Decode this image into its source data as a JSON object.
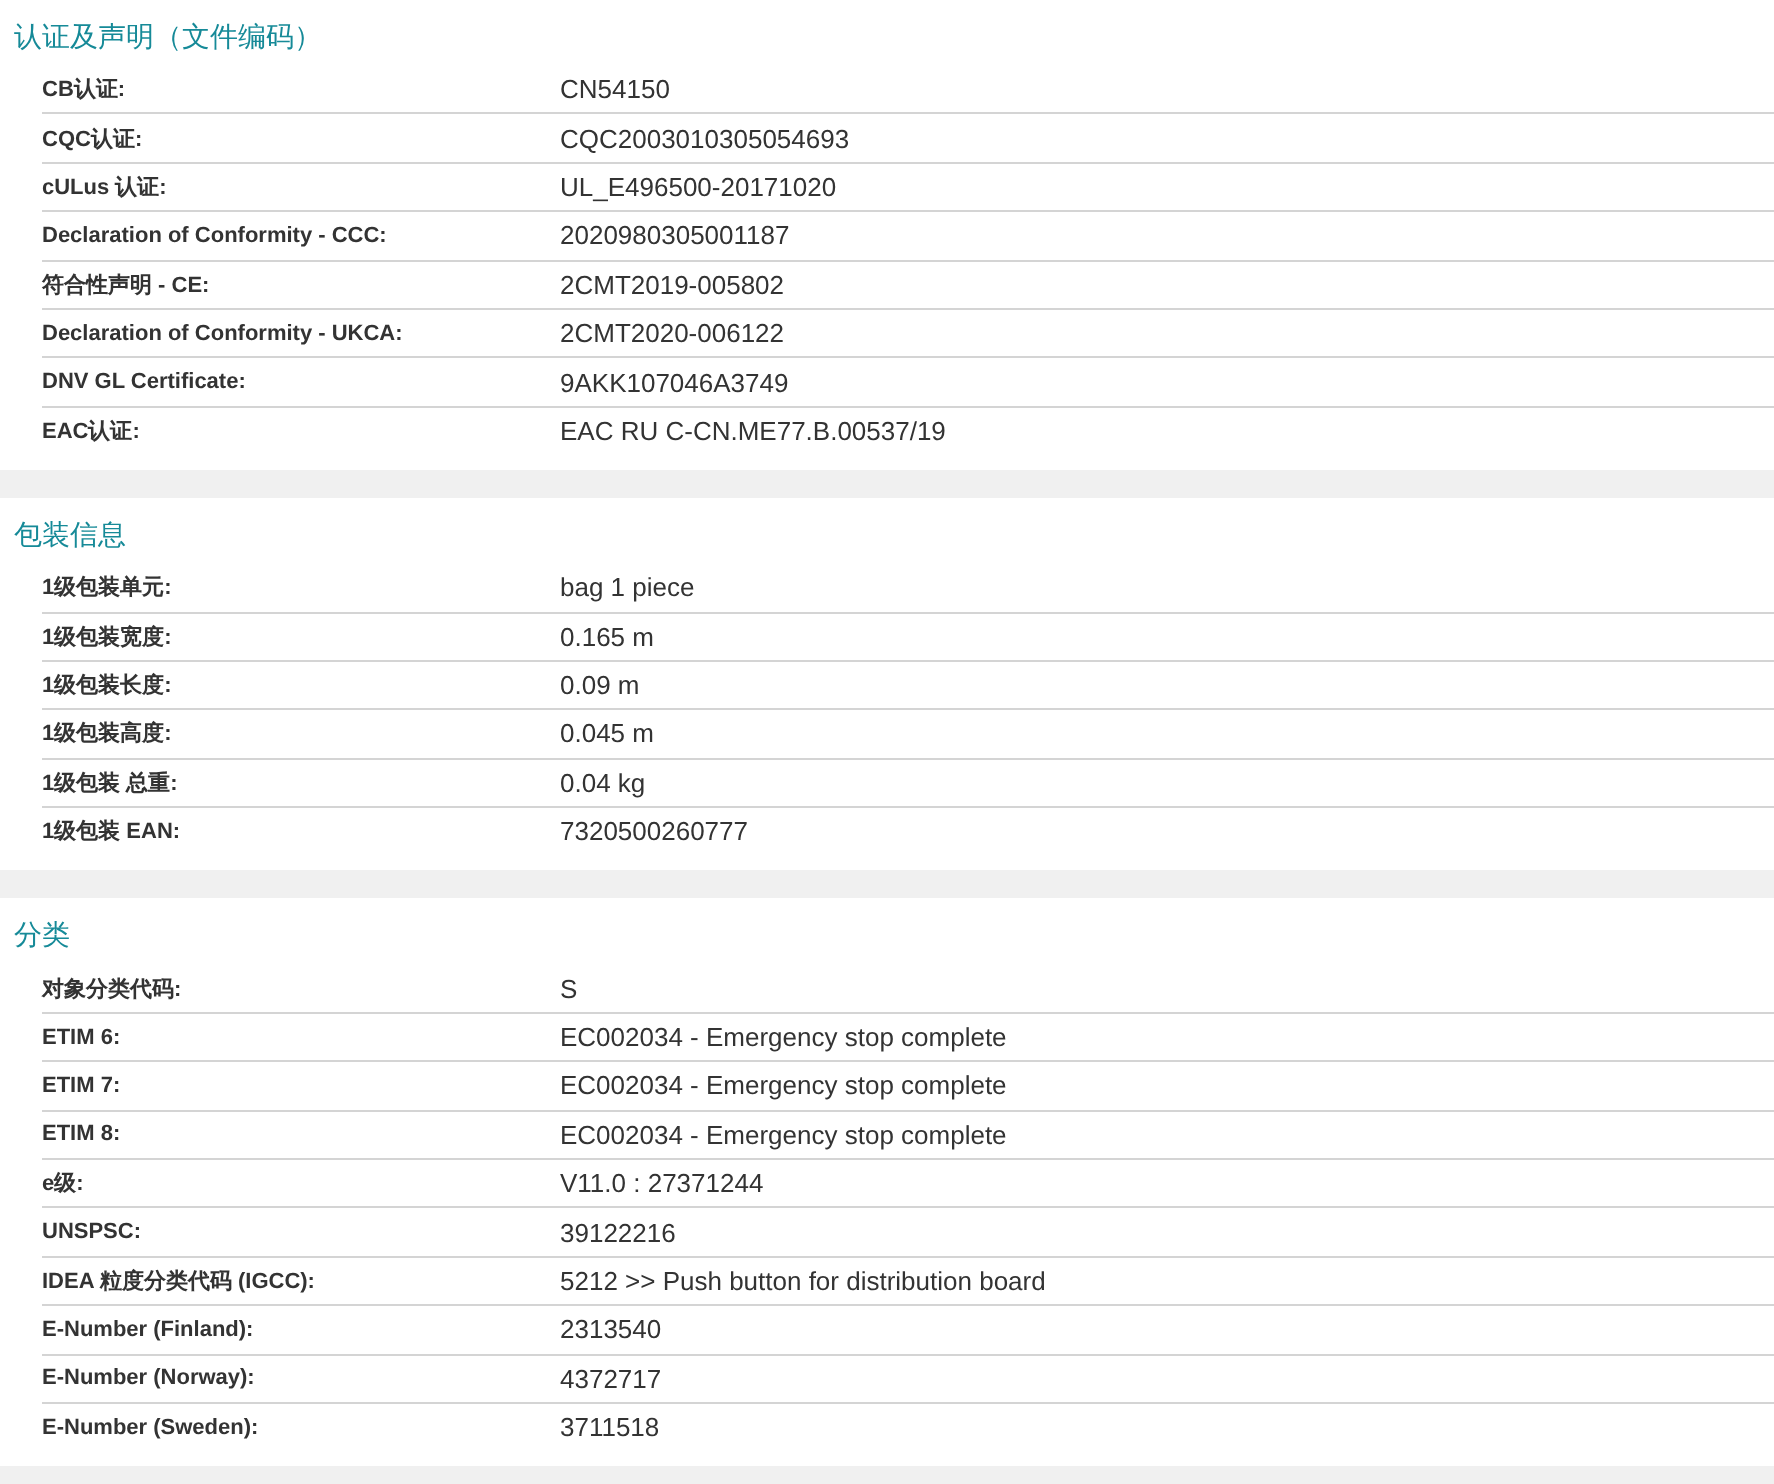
{
  "sections": [
    {
      "title": "认证及声明（文件编码）",
      "rows": [
        {
          "label": "CB认证:",
          "value": "CN54150"
        },
        {
          "label": "CQC认证:",
          "value": "CQC2003010305054693"
        },
        {
          "label": "cULus 认证:",
          "value": "UL_E496500-20171020"
        },
        {
          "label": "Declaration of Conformity - CCC:",
          "value": "2020980305001187"
        },
        {
          "label": "符合性声明 - CE:",
          "value": "2CMT2019-005802"
        },
        {
          "label": "Declaration of Conformity - UKCA:",
          "value": "2CMT2020-006122"
        },
        {
          "label": "DNV GL Certificate:",
          "value": "9AKK107046A3749"
        },
        {
          "label": "EAC认证:",
          "value": "EAC RU C-CN.ME77.B.00537/19"
        }
      ]
    },
    {
      "title": "包装信息",
      "rows": [
        {
          "label": "1级包装单元:",
          "value": "bag 1 piece"
        },
        {
          "label": "1级包装宽度:",
          "value": "0.165 m"
        },
        {
          "label": "1级包装长度:",
          "value": "0.09 m"
        },
        {
          "label": "1级包装高度:",
          "value": "0.045 m"
        },
        {
          "label": "1级包装 总重:",
          "value": "0.04 kg"
        },
        {
          "label": "1级包装 EAN:",
          "value": "7320500260777"
        }
      ]
    },
    {
      "title": "分类",
      "rows": [
        {
          "label": "对象分类代码:",
          "value": "S"
        },
        {
          "label": "ETIM 6:",
          "value": "EC002034 - Emergency stop complete"
        },
        {
          "label": "ETIM 7:",
          "value": "EC002034 - Emergency stop complete"
        },
        {
          "label": "ETIM 8:",
          "value": "EC002034 - Emergency stop complete"
        },
        {
          "label": "e级:",
          "value": "V11.0 : 27371244"
        },
        {
          "label": "UNSPSC:",
          "value": "39122216"
        },
        {
          "label": "IDEA 粒度分类代码 (IGCC):",
          "value": "5212 >> Push button for distribution board"
        },
        {
          "label": "E-Number (Finland):",
          "value": "2313540"
        },
        {
          "label": "E-Number (Norway):",
          "value": "4372717"
        },
        {
          "label": "E-Number (Sweden):",
          "value": "3711518"
        }
      ]
    }
  ]
}
